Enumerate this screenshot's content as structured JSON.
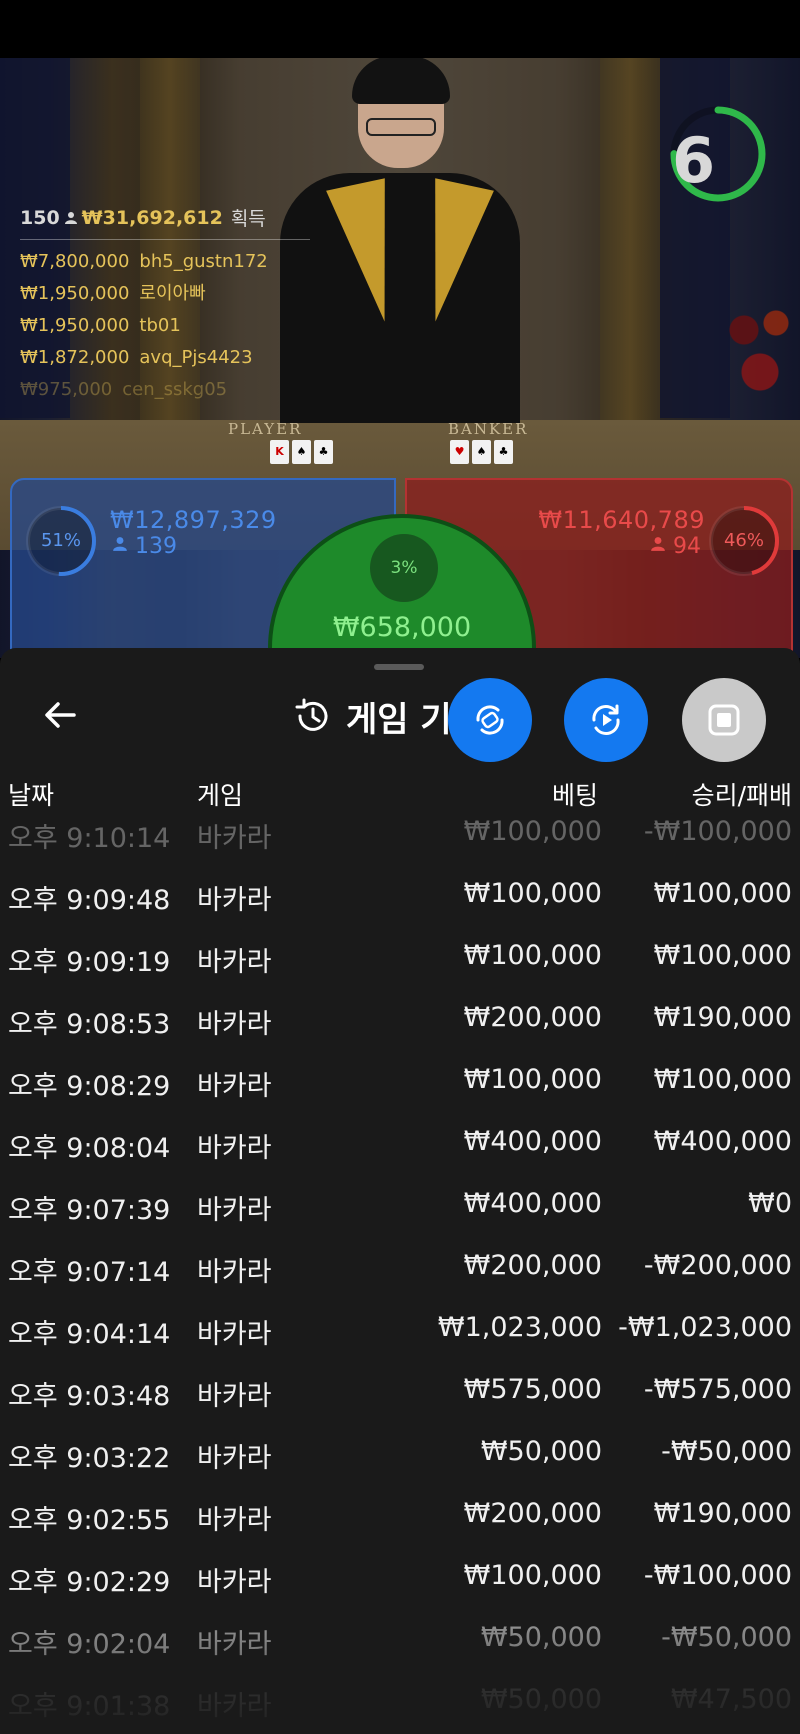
{
  "stage": {
    "table_labels": {
      "player": "PLAYER",
      "banker": "BANKER"
    },
    "countdown": {
      "value": "6",
      "progress": 0.75,
      "color": "#2fb84a"
    },
    "winners": {
      "count": "150",
      "total": "₩31,692,612",
      "earn_label": "획득",
      "list": [
        {
          "amount": "₩7,800,000",
          "user": "bh5_gustn172"
        },
        {
          "amount": "₩1,950,000",
          "user": "로이아빠"
        },
        {
          "amount": "₩1,950,000",
          "user": "tb01"
        },
        {
          "amount": "₩1,872,000",
          "user": "avq_Pjs4423"
        },
        {
          "amount": "₩975,000",
          "user": "cen_sskg05"
        }
      ]
    },
    "player_bet": {
      "percent": "51%",
      "percent_value": 0.51,
      "amount": "₩12,897,329",
      "players": "139",
      "color": "#3a7de0"
    },
    "banker_bet": {
      "percent": "46%",
      "percent_value": 0.46,
      "amount": "₩11,640,789",
      "players": "94",
      "color": "#e03a3a"
    },
    "tie_bet": {
      "percent": "3%",
      "percent_value": 0.03,
      "amount": "₩658,000",
      "color": "#3bd04a"
    }
  },
  "sheet": {
    "title": "게임 기",
    "columns": {
      "date": "날짜",
      "game": "게임",
      "bet": "베팅",
      "result": "승리/패배"
    },
    "rows": [
      {
        "date": "오후 9:10:14",
        "game": "바카라",
        "bet": "₩100,000",
        "result": "-₩100,000"
      },
      {
        "date": "오후 9:09:48",
        "game": "바카라",
        "bet": "₩100,000",
        "result": "₩100,000"
      },
      {
        "date": "오후 9:09:19",
        "game": "바카라",
        "bet": "₩100,000",
        "result": "₩100,000"
      },
      {
        "date": "오후 9:08:53",
        "game": "바카라",
        "bet": "₩200,000",
        "result": "₩190,000"
      },
      {
        "date": "오후 9:08:29",
        "game": "바카라",
        "bet": "₩100,000",
        "result": "₩100,000"
      },
      {
        "date": "오후 9:08:04",
        "game": "바카라",
        "bet": "₩400,000",
        "result": "₩400,000"
      },
      {
        "date": "오후 9:07:39",
        "game": "바카라",
        "bet": "₩400,000",
        "result": "₩0"
      },
      {
        "date": "오후 9:07:14",
        "game": "바카라",
        "bet": "₩200,000",
        "result": "-₩200,000"
      },
      {
        "date": "오후 9:04:14",
        "game": "바카라",
        "bet": "₩1,023,000",
        "result": "-₩1,023,000"
      },
      {
        "date": "오후 9:03:48",
        "game": "바카라",
        "bet": "₩575,000",
        "result": "-₩575,000"
      },
      {
        "date": "오후 9:03:22",
        "game": "바카라",
        "bet": "₩50,000",
        "result": "-₩50,000"
      },
      {
        "date": "오후 9:02:55",
        "game": "바카라",
        "bet": "₩200,000",
        "result": "₩190,000"
      },
      {
        "date": "오후 9:02:29",
        "game": "바카라",
        "bet": "₩100,000",
        "result": "-₩100,000"
      },
      {
        "date": "오후 9:02:04",
        "game": "바카라",
        "bet": "₩50,000",
        "result": "-₩50,000"
      },
      {
        "date": "오후 9:01:38",
        "game": "바카라",
        "bet": "₩50,000",
        "result": "₩47,500"
      }
    ]
  },
  "icons": {
    "back": "arrow-left-icon",
    "history": "history-clock-icon",
    "swap": "swap-camera-icon",
    "replay": "replay-icon",
    "stop": "stop-icon",
    "user": "user-icon"
  }
}
